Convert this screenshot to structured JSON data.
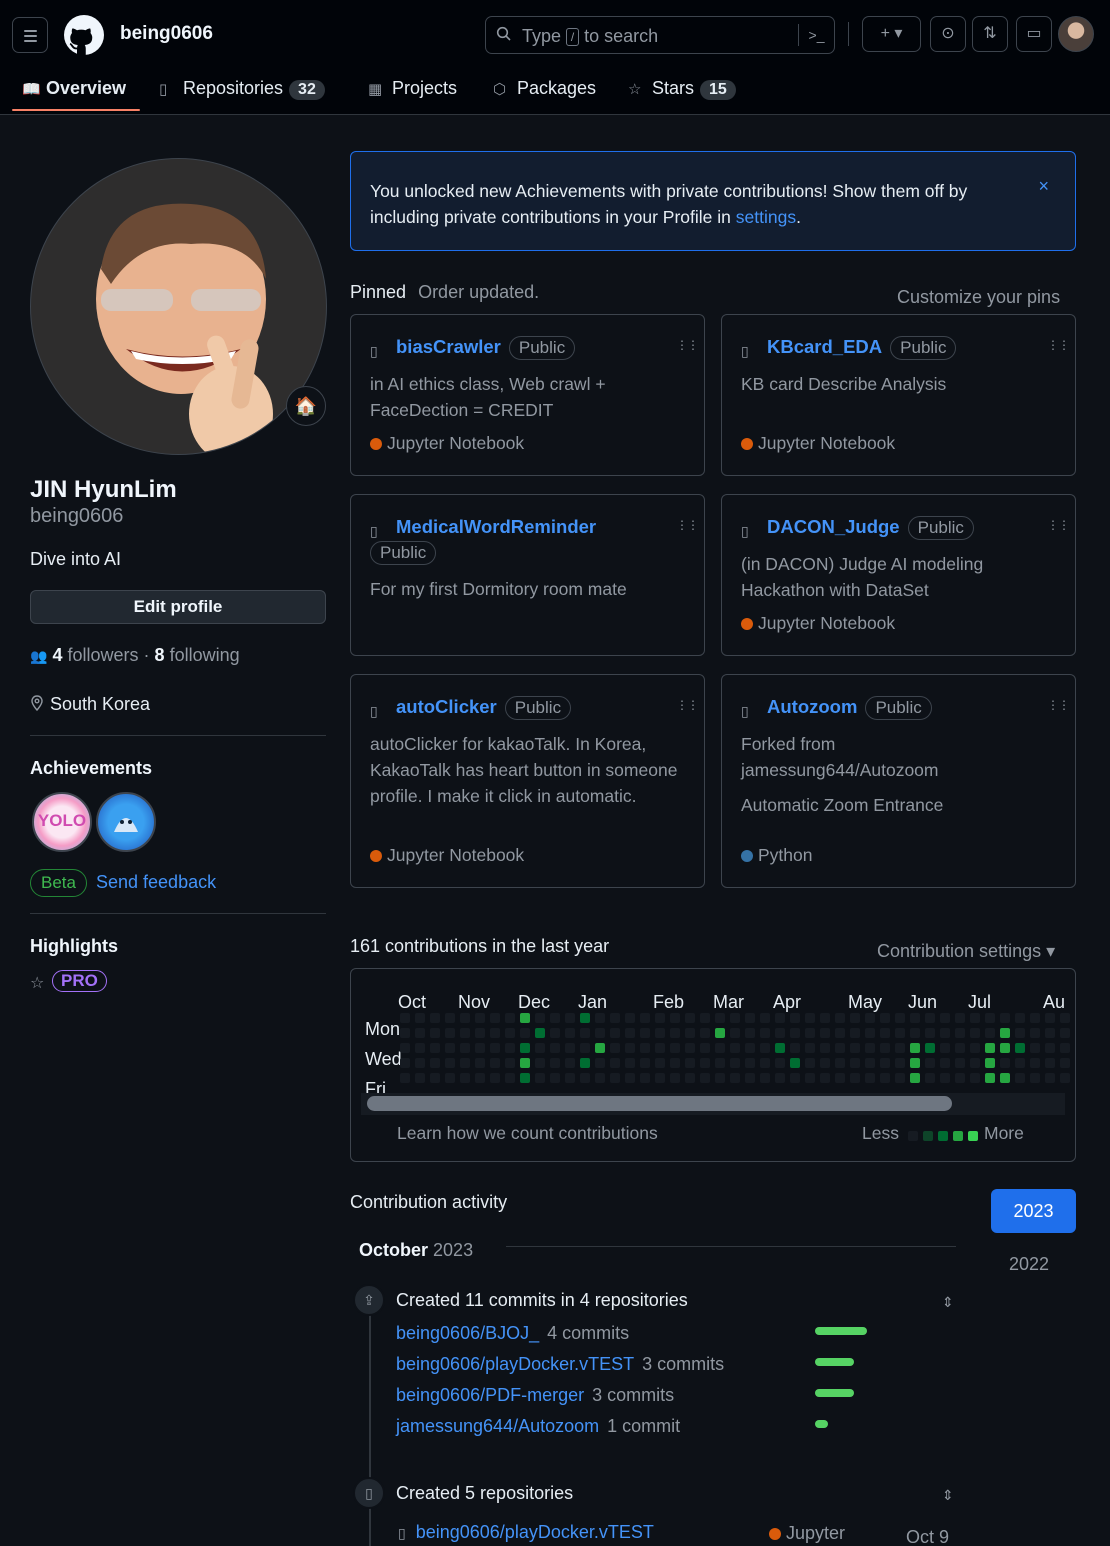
{
  "header": {
    "username": "being0606",
    "search_text": "Type",
    "search_key": "/",
    "search_suffix": "to search",
    "tabs": [
      {
        "label": "Overview"
      },
      {
        "label": "Repositories",
        "count": "32"
      },
      {
        "label": "Projects"
      },
      {
        "label": "Packages"
      },
      {
        "label": "Stars",
        "count": "15"
      }
    ]
  },
  "profile": {
    "fullname": "JIN HyunLim",
    "login": "being0606",
    "bio": "Dive into AI",
    "edit_label": "Edit profile",
    "followers": "4",
    "followers_label": "followers",
    "following": "8",
    "following_label": "following",
    "separator": "·",
    "location": "South Korea",
    "achievements_title": "Achievements",
    "badge1_text": "YOLO",
    "beta_label": "Beta",
    "feedback_label": "Send feedback",
    "highlights_title": "Highlights",
    "pro_label": "PRO"
  },
  "flash": {
    "text": "You unlocked new Achievements with private contributions! Show them off by including private contributions in your Profile in",
    "link": "settings",
    "end": ".",
    "close": "×"
  },
  "pinned": {
    "title": "Pinned",
    "status": "Order updated.",
    "customize": "Customize your pins",
    "repos": [
      {
        "name": "biasCrawler",
        "visibility": "Public",
        "desc": "in AI ethics class, Web crawl + FaceDection = CREDIT",
        "lang": "Jupyter Notebook",
        "lang_color": "#DA5B0B"
      },
      {
        "name": "KBcard_EDA",
        "visibility": "Public",
        "desc": "KB card Describe Analysis",
        "lang": "Jupyter Notebook",
        "lang_color": "#DA5B0B"
      },
      {
        "name": "MedicalWordReminder",
        "visibility": "Public",
        "desc": "For my first Dormitory room mate",
        "lang": "",
        "lang_color": ""
      },
      {
        "name": "DACON_Judge",
        "visibility": "Public",
        "desc": "(in DACON) Judge AI modeling Hackathon with DataSet",
        "lang": "Jupyter Notebook",
        "lang_color": "#DA5B0B"
      },
      {
        "name": "autoClicker",
        "visibility": "Public",
        "desc": "autoClicker for kakaoTalk. In Korea, KakaoTalk has heart button in someone profile. I make it click in automatic.",
        "lang": "Jupyter Notebook",
        "lang_color": "#DA5B0B"
      },
      {
        "name": "Autozoom",
        "visibility": "Public",
        "fork1": "Forked from",
        "fork2": "jamessung644/Autozoom",
        "desc": "Automatic Zoom Entrance",
        "lang": "Python",
        "lang_color": "#3572A5"
      }
    ]
  },
  "contributions": {
    "title": "161 contributions in the last year",
    "settings": "Contribution settings ▾",
    "months": [
      "Oct",
      "Nov",
      "Dec",
      "Jan",
      "Feb",
      "Mar",
      "Apr",
      "May",
      "Jun",
      "Jul",
      "Au"
    ],
    "days": [
      "Mon",
      "Wed",
      "Fri"
    ],
    "learn": "Learn how we count contributions",
    "less": "Less",
    "more": "More",
    "colors": [
      "#161b22",
      "#0e4429",
      "#006d32",
      "#26a641",
      "#39d353"
    ]
  },
  "activity": {
    "title": "Contribution activity",
    "years": [
      "2023",
      "2022"
    ],
    "month": "October",
    "month_year": "2023",
    "commits_title": "Created 11 commits in 4 repositories",
    "commits": [
      {
        "repo": "being0606/BJOJ_",
        "count": "4 commits",
        "ratio": 1.0
      },
      {
        "repo": "being0606/playDocker.vTEST",
        "count": "3 commits",
        "ratio": 0.75
      },
      {
        "repo": "being0606/PDF-merger",
        "count": "3 commits",
        "ratio": 0.75
      },
      {
        "repo": "jamessung644/Autozoom",
        "count": "1 commit",
        "ratio": 0.25
      }
    ],
    "repos_title": "Created 5 repositories",
    "created_repo": "being0606/playDocker.vTEST",
    "created_lang": "Jupyter",
    "created_date": "Oct 9"
  }
}
